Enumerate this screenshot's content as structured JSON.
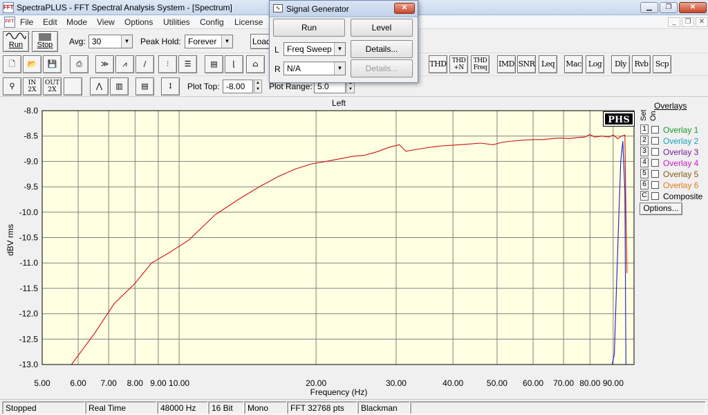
{
  "window": {
    "title": "SpectraPLUS - FFT Spectral Analysis System - [Spectrum]"
  },
  "menu": [
    "File",
    "Edit",
    "Mode",
    "View",
    "Options",
    "Utilities",
    "Config",
    "License"
  ],
  "toolbar1": {
    "run_label": "Run",
    "stop_label": "Stop",
    "avg_label": "Avg:",
    "avg_value": "30",
    "peak_hold_label": "Peak Hold:",
    "peak_hold_value": "Forever",
    "load_label": "Load"
  },
  "toolbar2": {
    "text_buttons": [
      "THD",
      "THD\n+N",
      "THD\nFreq",
      "IMD",
      "SNR",
      "Leq",
      "Mac",
      "Log",
      "Dly",
      "Rvb",
      "Scp"
    ]
  },
  "toolbar3": {
    "zoom_in_label": "IN 2X",
    "zoom_out_label": "OUT 2X",
    "zoom_full_label": "OUT FULL",
    "plot_top_label": "Plot Top:",
    "plot_top_value": "-8.00",
    "plot_range_label": "Plot Range:",
    "plot_range_value": "5.0"
  },
  "signal_generator": {
    "title": "Signal Generator",
    "run_label": "Run",
    "level_label": "Level",
    "left_channel_label": "L",
    "left_mode": "Freq Sweep",
    "left_details_label": "Details...",
    "right_channel_label": "R",
    "right_mode": "N/A",
    "right_details_label": "Details..."
  },
  "overlays": {
    "header": "Overlays",
    "set_label": "Set",
    "on_label": "On",
    "items": [
      {
        "num": "1",
        "name": "Overlay 1",
        "color": "#1a9a2a"
      },
      {
        "num": "2",
        "name": "Overlay 2",
        "color": "#1aa0b8"
      },
      {
        "num": "3",
        "name": "Overlay 3",
        "color": "#7a1a9a"
      },
      {
        "num": "4",
        "name": "Overlay 4",
        "color": "#c81ac8"
      },
      {
        "num": "5",
        "name": "Overlay 5",
        "color": "#8a5a10"
      },
      {
        "num": "6",
        "name": "Overlay 6",
        "color": "#e07a20"
      },
      {
        "num": "C",
        "name": "Composite",
        "color": "#000000"
      }
    ],
    "options_label": "Options..."
  },
  "status_bar": [
    "Stopped",
    "Real Time",
    "48000 Hz",
    "16 Bit",
    "Mono",
    "FFT 32768 pts",
    "Blackman"
  ],
  "chart_data": {
    "type": "line",
    "title": "Left",
    "xlabel": "Frequency (Hz)",
    "ylabel": "dBV rms",
    "x_scale": "log",
    "xlim": [
      5.0,
      100.0
    ],
    "ylim": [
      -13.0,
      -8.0
    ],
    "grid": true,
    "background": "#ffffe1",
    "x_ticks": [
      5.0,
      6.0,
      7.0,
      8.0,
      9.0,
      10.0,
      20.0,
      30.0,
      40.0,
      50.0,
      60.0,
      70.0,
      80.0,
      90.0
    ],
    "x_tick_labels": [
      "5.00",
      "6.00",
      "7.00",
      "8.00",
      "9.00",
      "10.00",
      "20.00",
      "30.00",
      "40.00",
      "50.00",
      "60.00",
      "70.00",
      "80.00",
      "90.00"
    ],
    "y_ticks": [
      -8.0,
      -8.5,
      -9.0,
      -9.5,
      -10.0,
      -10.5,
      -11.0,
      -11.5,
      -12.0,
      -12.5,
      -13.0
    ],
    "y_tick_labels": [
      "-8.0",
      "-8.5",
      "-9.0",
      "-9.5",
      "-10.0",
      "-10.5",
      "-11.0",
      "-11.5",
      "-12.0",
      "-12.5",
      "-13.0"
    ],
    "badge": "PHS",
    "series": [
      {
        "color": "#cc1010",
        "x": [
          5.8,
          6.5,
          7.2,
          8.0,
          8.7,
          9.5,
          10.5,
          12.0,
          13.5,
          15.0,
          16.5,
          18.0,
          19.5,
          21.0,
          22.5,
          24.0,
          25.5,
          27.0,
          29.0,
          30.5,
          31.5,
          34.0,
          37.0,
          40.0,
          43.0,
          46.0,
          49.0,
          51.5,
          54.0,
          57.0,
          60.0,
          63.0,
          66.0,
          69.0,
          72.0,
          75.0,
          78.0,
          80.0,
          82.0,
          85.0,
          88.0,
          90.0,
          92.0,
          94.0,
          95.5,
          96.0,
          96.5
        ],
        "y": [
          -13.0,
          -12.4,
          -11.8,
          -11.4,
          -11.0,
          -10.8,
          -10.55,
          -10.05,
          -9.75,
          -9.5,
          -9.3,
          -9.15,
          -9.05,
          -9.0,
          -8.95,
          -8.9,
          -8.88,
          -8.82,
          -8.72,
          -8.67,
          -8.8,
          -8.75,
          -8.7,
          -8.68,
          -8.66,
          -8.64,
          -8.67,
          -8.62,
          -8.6,
          -8.58,
          -8.57,
          -8.57,
          -8.55,
          -8.54,
          -8.55,
          -8.53,
          -8.52,
          -8.47,
          -8.52,
          -8.5,
          -8.52,
          -8.48,
          -8.55,
          -8.5,
          -8.48,
          -10.0,
          -11.2
        ]
      },
      {
        "color": "#1a1acc",
        "x": [
          89.5,
          90.5,
          91.5,
          92.5,
          93.5,
          94.5,
          95.5,
          96.0
        ],
        "y": [
          -13.0,
          -12.8,
          -11.5,
          -10.2,
          -9.0,
          -8.6,
          -9.6,
          -13.0
        ]
      }
    ]
  }
}
